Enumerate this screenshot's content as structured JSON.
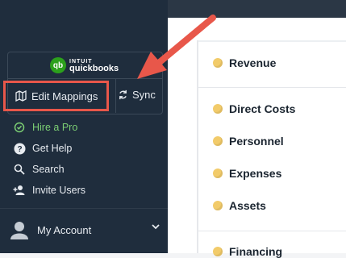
{
  "sidebar": {
    "quickbooks": {
      "badge": "qb",
      "intuit": "INTUIT",
      "brand": "quickbooks"
    },
    "edit_mappings": "Edit Mappings",
    "sync": "Sync",
    "nav": [
      {
        "label": "Hire a Pro",
        "icon": "target-icon"
      },
      {
        "label": "Get Help",
        "icon": "help-icon"
      },
      {
        "label": "Search",
        "icon": "search-icon"
      },
      {
        "label": "Invite Users",
        "icon": "add-user-icon"
      }
    ],
    "account": "My Account"
  },
  "main": {
    "items": [
      "Revenue",
      "Direct Costs",
      "Personnel",
      "Expenses",
      "Assets",
      "Financing"
    ]
  },
  "colors": {
    "sidebar_bg": "#1f2d3d",
    "highlight": "#e8574a",
    "hire_green": "#7ccf74",
    "dot_yellow": "#f2cb6a"
  }
}
